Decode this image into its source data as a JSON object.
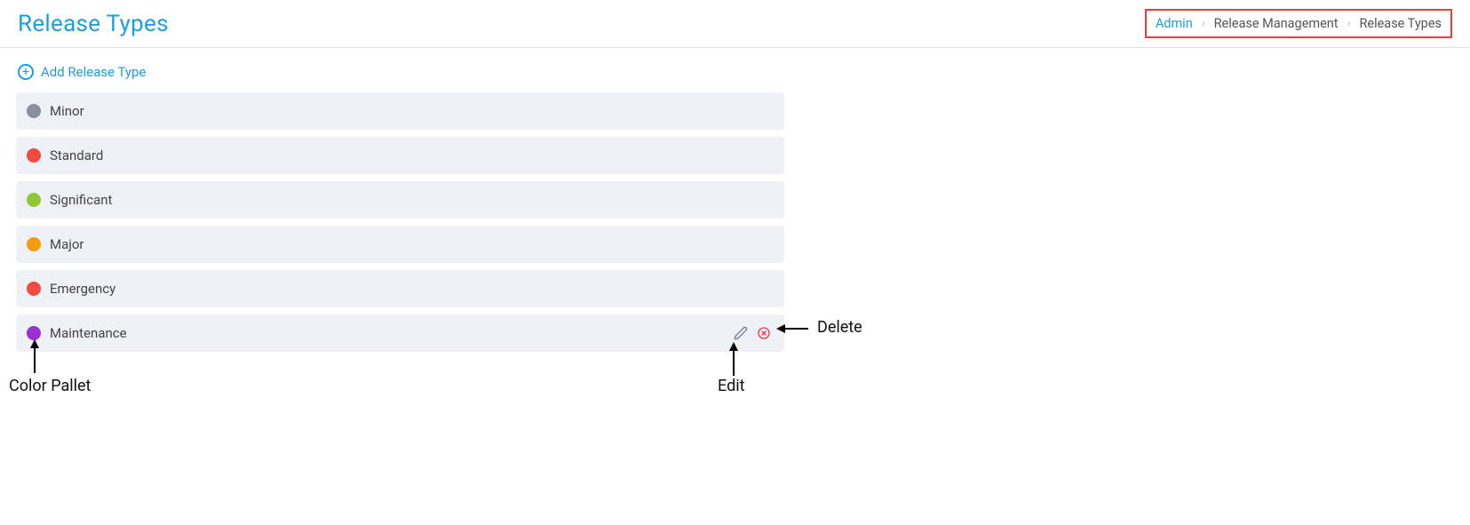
{
  "header": {
    "title": "Release Types"
  },
  "breadcrumb": {
    "items": [
      "Admin",
      "Release Management",
      "Release Types"
    ]
  },
  "actions": {
    "add_label": "Add Release Type"
  },
  "types": [
    {
      "label": "Minor",
      "color": "#8a919d",
      "show_actions": false
    },
    {
      "label": "Standard",
      "color": "#f04b3e",
      "show_actions": false
    },
    {
      "label": "Significant",
      "color": "#8fc93a",
      "show_actions": false
    },
    {
      "label": "Major",
      "color": "#f39c12",
      "show_actions": false
    },
    {
      "label": "Emergency",
      "color": "#f04b3e",
      "show_actions": false
    },
    {
      "label": "Maintenance",
      "color": "#9b2fd6",
      "show_actions": true
    }
  ],
  "annotations": {
    "color_pallet": "Color Pallet",
    "edit": "Edit",
    "delete": "Delete"
  }
}
